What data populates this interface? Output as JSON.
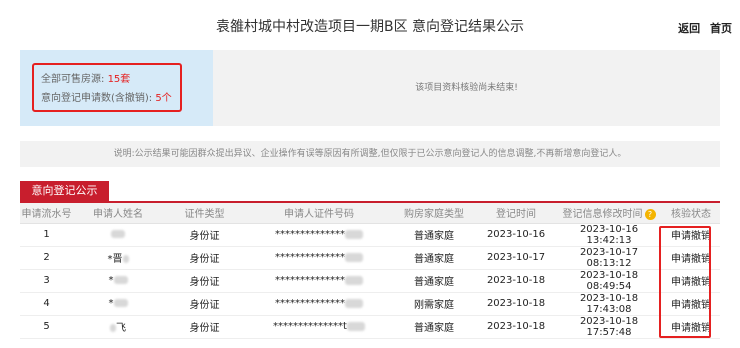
{
  "header": {
    "title": "袁雒村城中村改造项目一期B区 意向登记结果公示",
    "nav_back": "返回",
    "nav_home": "首页"
  },
  "summary": {
    "total_label": "全部可售房源:",
    "total_value": "15套",
    "applications_label": "意向登记申请数(含撤销):",
    "applications_value": "5个",
    "status_message": "该项目资料核验尚未结束!"
  },
  "notice": "说明:公示结果可能因群众提出异议、企业操作有误等原因有所调整,但仅限于已公示意向登记人的信息调整,不再新增意向登记人。",
  "tab": {
    "label": "意向登记公示"
  },
  "table": {
    "headers": [
      "申请流水号",
      "申请人姓名",
      "证件类型",
      "申请人证件号码",
      "购房家庭类型",
      "登记时间",
      "登记信息修改时间",
      "核验状态"
    ],
    "rows": [
      {
        "no": "1",
        "name": "",
        "id_type": "身份证",
        "id_number": "**************",
        "family_type": "普通家庭",
        "reg_time": "2023-10-16",
        "mod_time": "2023-10-16 13:42:13",
        "status": "申请撤销"
      },
      {
        "no": "2",
        "name": "*晋",
        "id_type": "身份证",
        "id_number": "**************",
        "family_type": "普通家庭",
        "reg_time": "2023-10-17",
        "mod_time": "2023-10-17 08:13:12",
        "status": "申请撤销"
      },
      {
        "no": "3",
        "name": "*",
        "id_type": "身份证",
        "id_number": "**************",
        "family_type": "普通家庭",
        "reg_time": "2023-10-18",
        "mod_time": "2023-10-18 08:49:54",
        "status": "申请撤销"
      },
      {
        "no": "4",
        "name": "*",
        "id_type": "身份证",
        "id_number": "**************",
        "family_type": "刚需家庭",
        "reg_time": "2023-10-18",
        "mod_time": "2023-10-18 17:43:08",
        "status": "申请撤销"
      },
      {
        "no": "5",
        "name": "飞",
        "id_type": "身份证",
        "id_number": "**************t",
        "family_type": "普通家庭",
        "reg_time": "2023-10-18",
        "mod_time": "2023-10-18 17:57:48",
        "status": "申请撤销"
      }
    ]
  },
  "help_icon": "question-icon",
  "colors": {
    "accent_red": "#c81e2d",
    "highlight_red": "#e52020",
    "summary_blue": "#d6eaf8",
    "help_yellow": "#f4b400"
  }
}
